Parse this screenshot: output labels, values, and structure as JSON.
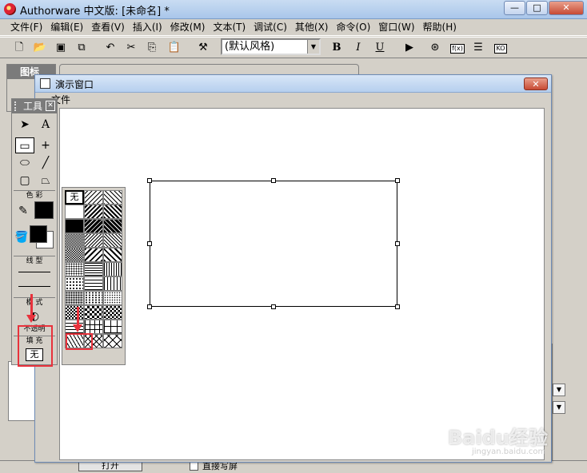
{
  "app": {
    "title": "Authorware 中文版: [未命名] *",
    "window_buttons": {
      "minimize": "—",
      "maximize": "□",
      "close": "✕"
    }
  },
  "menubar": [
    "文件(F)",
    "编辑(E)",
    "查看(V)",
    "插入(I)",
    "修改(M)",
    "文本(T)",
    "调试(C)",
    "其他(X)",
    "命令(O)",
    "窗口(W)",
    "帮助(H)"
  ],
  "toolbar": {
    "style_select": "(默认风格)",
    "bold": "B",
    "italic": "I",
    "underline": "U",
    "fn_label": "f(x)",
    "ko_label": "KO"
  },
  "icon_panel": {
    "title": "图标"
  },
  "presentation": {
    "title": "演示窗口",
    "menu": "文件",
    "close": "✕"
  },
  "tools": {
    "title": "工具",
    "close": "☒",
    "sections": {
      "color": "色 彩",
      "line": "线 型",
      "mode": "模 式",
      "mode_value": "不透明",
      "fill": "填 充"
    },
    "fill_value": "无"
  },
  "palette": {
    "none_label": "无"
  },
  "bottom": {
    "open_label": "打开",
    "checkbox_label": "直接写屏"
  },
  "watermark": {
    "text": "Baidu经验",
    "sub": "jingyan.baidu.com"
  },
  "colors": {
    "annotation_red": "#e8323c",
    "title_blue": "#b6cfee"
  }
}
